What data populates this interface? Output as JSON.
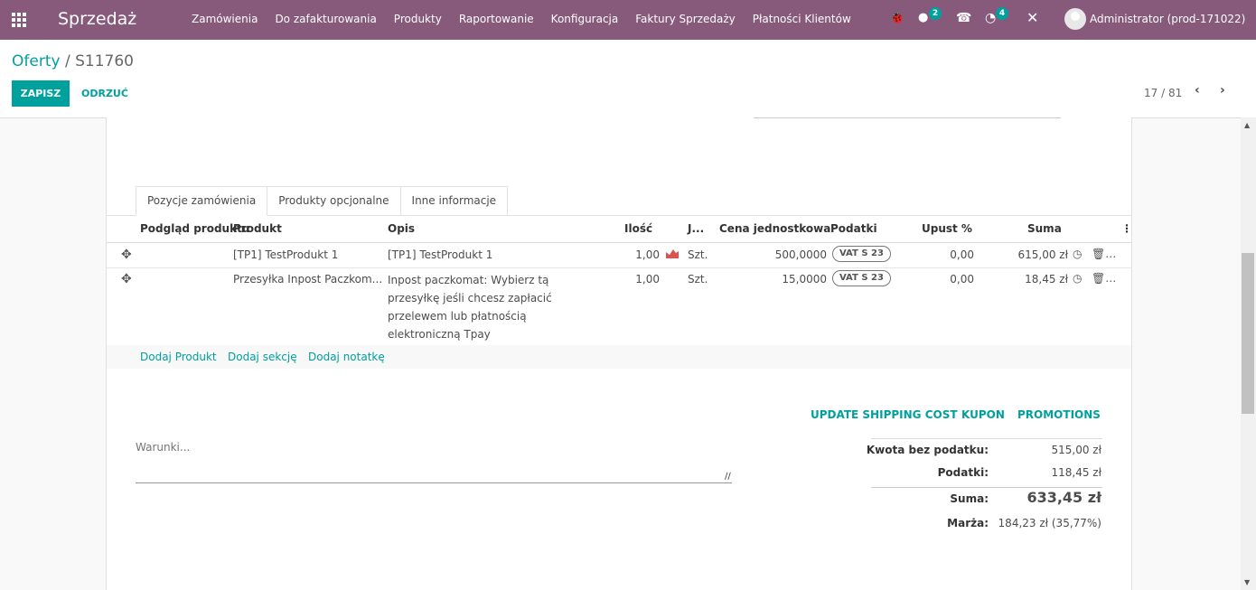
{
  "navbar": {
    "app_title": "Sprzedaż",
    "menu": [
      "Zamówienia",
      "Do zafakturowania",
      "Produkty",
      "Raportowanie",
      "Konfiguracja",
      "Faktury Sprzedaży",
      "Płatności Klientów"
    ],
    "messages_badge": "2",
    "activities_badge": "4",
    "user": "Administrator (prod-171022)"
  },
  "control": {
    "breadcrumb_parent": "Oferty",
    "breadcrumb_sep": "/",
    "breadcrumb_current": "S11760",
    "save_label": "ZAPISZ",
    "discard_label": "ODRZUĆ",
    "pager": "17 / 81"
  },
  "tabs": [
    "Pozycje zamówienia",
    "Produkty opcjonalne",
    "Inne informacje"
  ],
  "table": {
    "headers": {
      "preview": "Podgląd produktu",
      "product": "Produkt",
      "description": "Opis",
      "qty": "Ilość",
      "uom": "J...",
      "unit_price": "Cena jednostkowa",
      "taxes": "Podatki",
      "discount": "Upust %",
      "subtotal": "Suma"
    },
    "rows": [
      {
        "product": "[TP1] TestProdukt 1",
        "description": "[TP1] TestProdukt 1",
        "qty": "1,00",
        "uom": "Szt.",
        "unit_price": "500,0000",
        "tax": "VAT S 23",
        "discount": "0,00",
        "subtotal": "615,00 zł"
      },
      {
        "product": "Przesyłka Inpost Paczkom...",
        "description": "Inpost paczkomat: Wybierz tą przesyłkę jeśli chcesz zapłacić przelewem lub płatnością elektroniczną Tpay",
        "qty": "1,00",
        "uom": "Szt.",
        "unit_price": "15,0000",
        "tax": "VAT S 23",
        "discount": "0,00",
        "subtotal": "18,45 zł"
      }
    ],
    "add_product": "Dodaj Produkt",
    "add_section": "Dodaj sekcję",
    "add_note": "Dodaj notatkę"
  },
  "actions": {
    "update_shipping": "UPDATE SHIPPING COST",
    "coupon": "KUPON",
    "promotions": "PROMOTIONS"
  },
  "terms_placeholder": "Warunki...",
  "totals": {
    "untaxed_label": "Kwota bez podatku:",
    "untaxed_value": "515,00 zł",
    "taxes_label": "Podatki:",
    "taxes_value": "118,45 zł",
    "total_label": "Suma:",
    "total_value": "633,45 zł",
    "margin_label": "Marża:",
    "margin_value": "184,23 zł (35,77%)"
  },
  "colors": {
    "navbar": "#875a7b",
    "accent": "#00a09d",
    "forecast": "#d9534f"
  }
}
